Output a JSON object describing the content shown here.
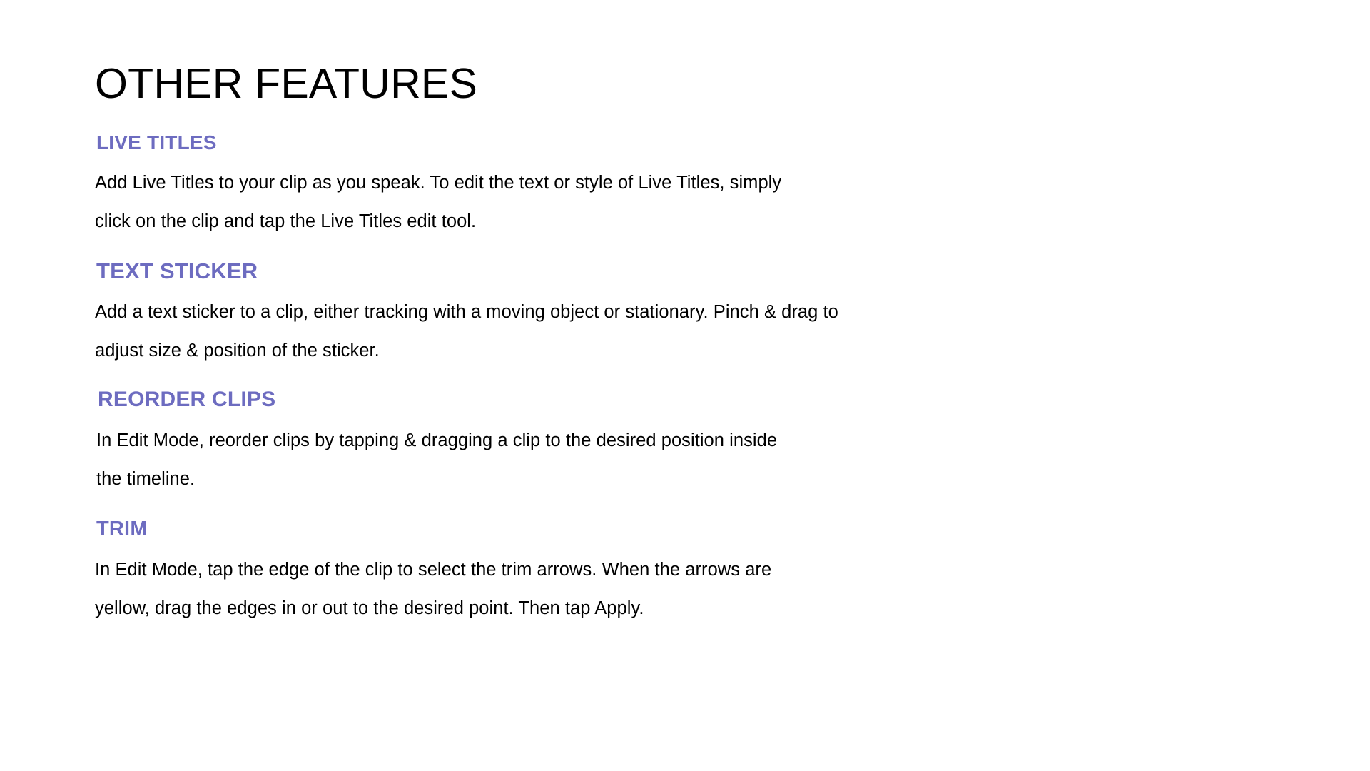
{
  "slide": {
    "title": "OTHER FEATURES",
    "background_color": "#FFFFFF",
    "title_color": "#000000",
    "heading_color": "#6D6CC0",
    "body_color": "#000000",
    "sections": [
      {
        "heading": "LIVE TITLES",
        "body": "Add Live Titles to your clip as you speak. To edit the text or style of Live Titles, simply click on the clip and tap the Live Titles edit tool."
      },
      {
        "heading": "TEXT STICKER",
        "body": "Add a text sticker to a clip, either tracking with a moving object or stationary. Pinch & drag to adjust size & position of the sticker."
      },
      {
        "heading": "REORDER CLIPS",
        "body": "In Edit Mode, reorder clips by tapping & dragging a clip to the desired position inside the timeline."
      },
      {
        "heading": "TRIM",
        "body": "In Edit Mode, tap the edge of the clip to select the trim arrows. When the arrows are yellow, drag the edges in or out to the desired point. Then tap Apply."
      }
    ]
  }
}
